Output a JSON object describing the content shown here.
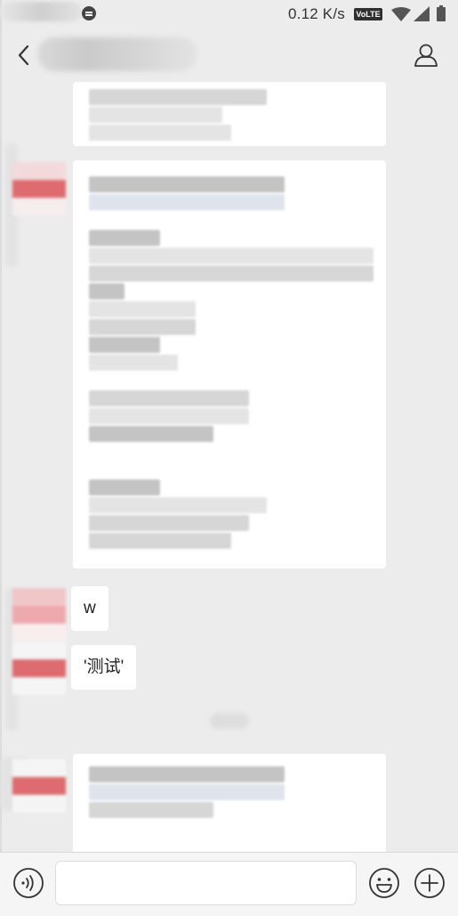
{
  "status_bar": {
    "net_speed": "0.12 K/s",
    "volte_label": "VoLTE",
    "icons": [
      "notification-icon",
      "wifi-icon",
      "signal-icon",
      "battery-icon"
    ]
  },
  "header": {
    "back_icon": "chevron-left-icon",
    "title": "",
    "profile_icon": "person-icon"
  },
  "messages": [
    {
      "id": 1,
      "type": "blurred-text"
    },
    {
      "id": 2,
      "type": "blurred-text"
    },
    {
      "id": 3,
      "type": "text",
      "text": "w"
    },
    {
      "id": 4,
      "type": "text",
      "text": "'测试'"
    },
    {
      "id": 5,
      "type": "blurred-text"
    }
  ],
  "input_bar": {
    "voice_icon": "voice-icon",
    "input_value": "",
    "emoji_icon": "emoji-icon",
    "plus_icon": "plus-circle-icon"
  },
  "colors": {
    "background": "#ececec",
    "bubble": "#ffffff",
    "avatar_accent": "#dd6b70"
  }
}
